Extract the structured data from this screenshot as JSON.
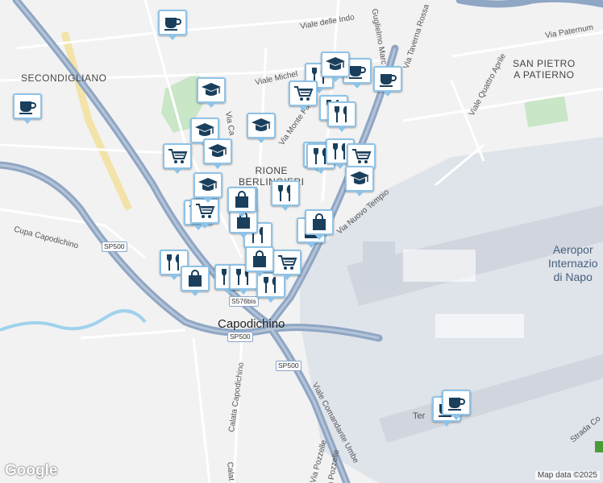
{
  "map": {
    "areas": {
      "secondigliano": "SECONDIGLIANO",
      "san_pietro": "SAN PIETRO\nA PATIERNO",
      "rione": "RIONE\nBERLINGIERI"
    },
    "places": {
      "capodichino": "Capodichino",
      "airport": "Aeropor\nInternazio\ndi Napo",
      "terminal": "Ter"
    },
    "streets": [
      "Viale delle Indo",
      "Via Paternum",
      "Viale Michel",
      "Via Nuovo Tempio",
      "Cupa Capodichino",
      "Calata Capodichino",
      "Viale Comandante Umbe",
      "Strada Co",
      "Via Pozzelle",
      "Viale Quattro Aprile",
      "Via Taverna Rossa",
      "Guglielmo Marc",
      "Via Ca",
      "Via Monte Fa",
      "Calat",
      "Cupa Pozzelle"
    ],
    "shields": [
      "SP500",
      "SP500",
      "SP500",
      "S576bis"
    ]
  },
  "pins": [
    {
      "icon": "coffee-icon"
    },
    {
      "icon": "coffee-icon"
    },
    {
      "icon": "coffee-icon"
    },
    {
      "icon": "coffee-icon"
    },
    {
      "icon": "coffee-icon"
    },
    {
      "icon": "coffee-icon"
    },
    {
      "icon": "restaurant-icon"
    },
    {
      "icon": "restaurant-icon"
    },
    {
      "icon": "restaurant-icon"
    },
    {
      "icon": "restaurant-icon"
    },
    {
      "icon": "restaurant-icon"
    },
    {
      "icon": "restaurant-icon"
    },
    {
      "icon": "restaurant-icon"
    },
    {
      "icon": "restaurant-icon"
    },
    {
      "icon": "restaurant-icon"
    },
    {
      "icon": "restaurant-icon"
    },
    {
      "icon": "restaurant-icon"
    },
    {
      "icon": "restaurant-icon"
    },
    {
      "icon": "cart-icon"
    },
    {
      "icon": "cart-icon"
    },
    {
      "icon": "cart-icon"
    },
    {
      "icon": "cart-icon"
    },
    {
      "icon": "cart-icon"
    },
    {
      "icon": "cart-icon"
    },
    {
      "icon": "cart-icon"
    },
    {
      "icon": "school-icon"
    },
    {
      "icon": "school-icon"
    },
    {
      "icon": "school-icon"
    },
    {
      "icon": "school-icon"
    },
    {
      "icon": "school-icon"
    },
    {
      "icon": "school-icon"
    },
    {
      "icon": "school-icon"
    },
    {
      "icon": "shopping-bag-icon"
    },
    {
      "icon": "shopping-bag-icon"
    },
    {
      "icon": "shopping-bag-icon"
    },
    {
      "icon": "shopping-bag-icon"
    },
    {
      "icon": "shopping-bag-icon"
    },
    {
      "icon": "shopping-bag-icon"
    }
  ],
  "footer": {
    "logo": "Google",
    "attribution": "Map data ©2025"
  },
  "colors": {
    "background": "#f2f2f2",
    "highway": "#8fa6c4",
    "pin_border": "#8ec3e8",
    "icon": "#1a3f5c",
    "airport": "#dfe3ea",
    "park": "#c9e6c7",
    "river": "#9fd2ec"
  }
}
